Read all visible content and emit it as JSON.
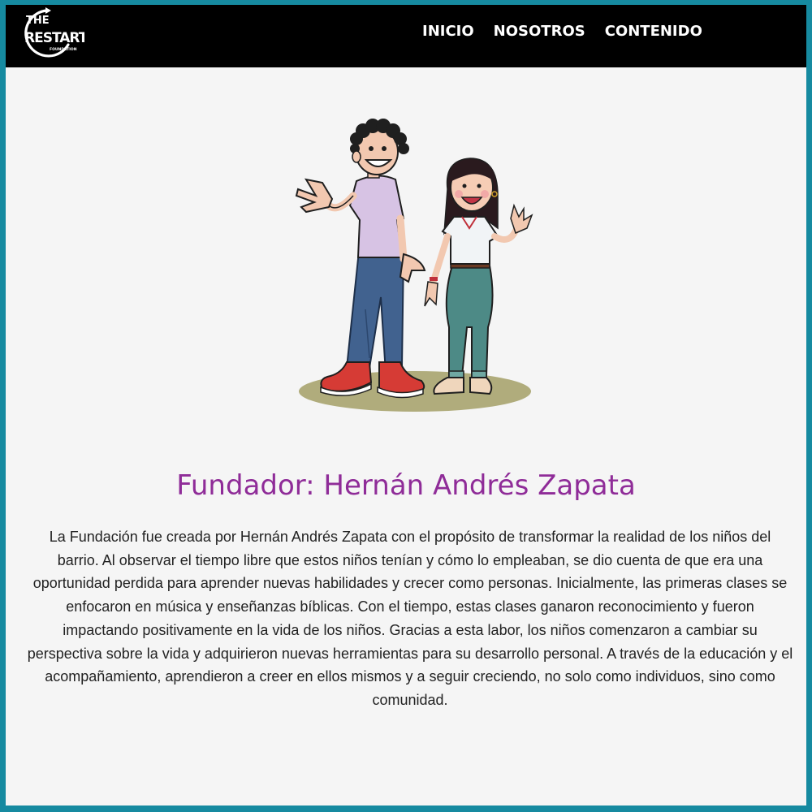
{
  "brand": {
    "logo_line1": "THE",
    "logo_line2": "RESTART",
    "logo_line3": "FOUNDATION"
  },
  "nav": {
    "items": [
      {
        "label": "INICIO"
      },
      {
        "label": "NOSOTROS"
      },
      {
        "label": "CONTENIDO"
      }
    ]
  },
  "main": {
    "title": "Fundador: Hernán Andrés Zapata",
    "paragraph": "La Fundación fue creada por Hernán Andrés Zapata con el propósito de transformar la realidad de los niños del barrio. Al observar el tiempo libre que estos niños tenían y cómo lo empleaban, se dio cuenta de que era una oportunidad perdida para aprender nuevas habilidades y crecer como personas. Inicialmente, las primeras clases se enfocaron en música y enseñanzas bíblicas. Con el tiempo, estas clases ganaron reconocimiento y fueron impactando positivamente en la vida de los niños. Gracias a esta labor, los niños comenzaron a cambiar su perspectiva sobre la vida y adquirieron nuevas herramientas para su desarrollo personal. A través de la educación y el acompañamiento, aprendieron a creer en ellos mismos y a seguir creciendo, no solo como individuos, sino como comunidad."
  },
  "colors": {
    "frame_border": "#168aa0",
    "navbar_bg": "#000000",
    "page_bg": "#f5f5f5",
    "title": "#8f2c98",
    "text": "#222222"
  }
}
